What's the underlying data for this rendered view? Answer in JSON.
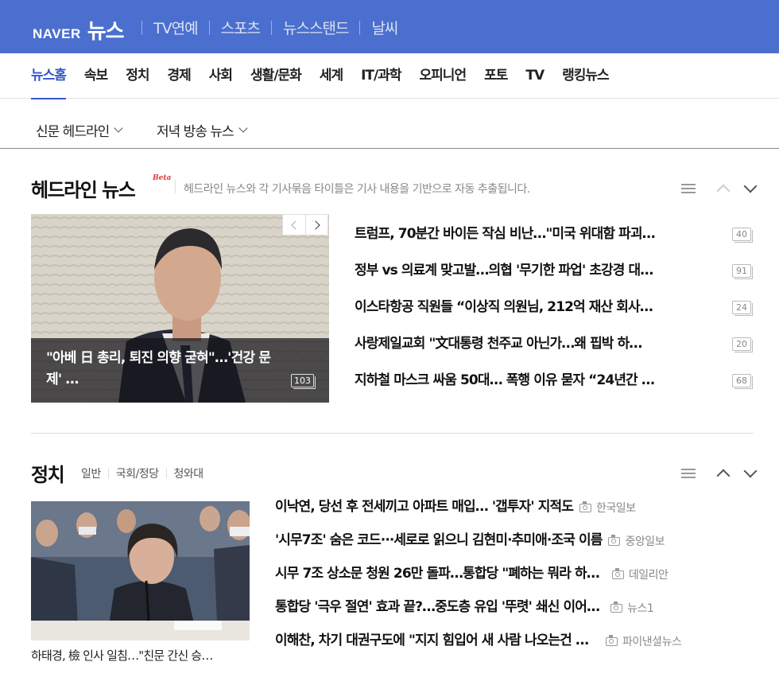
{
  "header": {
    "logo_brand": "NAVER",
    "logo_service": "뉴스",
    "links": [
      "TV연예",
      "스포츠",
      "뉴스스탠드",
      "날씨"
    ]
  },
  "category_nav": {
    "items": [
      "뉴스홈",
      "속보",
      "정치",
      "경제",
      "사회",
      "생활/문화",
      "세계",
      "IT/과학",
      "오피니언",
      "포토",
      "TV",
      "랭킹뉴스"
    ],
    "active": "뉴스홈"
  },
  "sub_nav": {
    "newspaper": "신문 헤드라인",
    "evening": "저녁 방송 뉴스"
  },
  "headline": {
    "title": "헤드라인 뉴스",
    "beta": "Beta",
    "description": "헤드라인 뉴스와 각 기사묶음 타이틀은 기사 내용을 기반으로 자동 추출됩니다.",
    "photo_caption": "\"아베 日 총리, 퇴진 의향 굳혀\"…'건강 문제' …",
    "photo_count": "103",
    "items": [
      {
        "title": "트럼프, 70분간 바이든 작심 비난…\"미국 위대함 파괴…",
        "count": "40"
      },
      {
        "title": "정부 vs 의료계 맞고발…의협 '무기한 파업' 초강경 대…",
        "count": "91"
      },
      {
        "title": "이스타항공 직원들 “이상직 의원님, 212억 재산 회사…",
        "count": "24"
      },
      {
        "title": "사랑제일교회 \"文대통령 천주교 아닌가…왜 핍박 하…",
        "count": "20"
      },
      {
        "title": "지하철 마스크 싸움 50대… 폭행 이유 묻자 “24년간 …",
        "count": "68"
      }
    ]
  },
  "politics": {
    "title": "정치",
    "tabs": [
      "일반",
      "국회/정당",
      "청와대"
    ],
    "photo_caption": "하태경, 檢 인사 일침…\"친문 간신 승…",
    "items": [
      {
        "title": "이낙연, 당선 후 전세끼고 아파트 매입… '갭투자' 지적도",
        "source": "한국일보"
      },
      {
        "title": "'시무7조' 숨은 코드···세로로 읽으니 김현미·추미애·조국 이름",
        "source": "중앙일보"
      },
      {
        "title": "시무 7조 상소문 청원 26만 돌파…통합당 \"폐하는 뭐라 하…",
        "source": "데일리안"
      },
      {
        "title": "통합당 '극우 절연' 효과 끝?…중도층 유입 '뚜렷' 쇄신 이어…",
        "source": "뉴스1"
      },
      {
        "title": "이해찬, 차기 대권구도에 \"지지 힘입어 새 사람 나오는건 …",
        "source": "파이낸셜뉴스"
      }
    ]
  },
  "colors": {
    "brand_blue": "#4b6fce",
    "active_blue": "#3458c8",
    "beta_red": "#e0383e"
  }
}
